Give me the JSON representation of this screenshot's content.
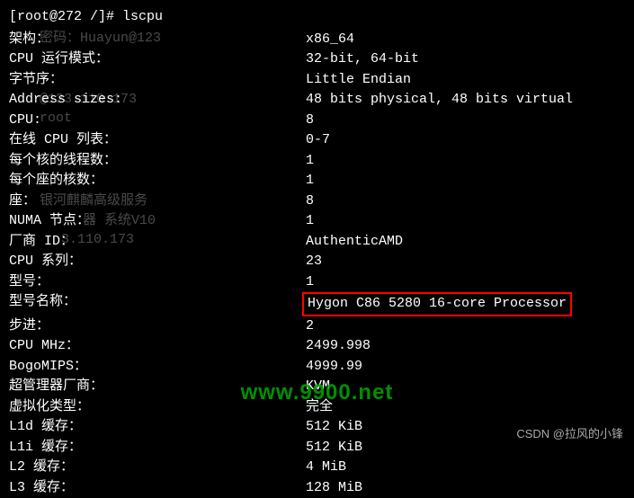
{
  "prompt": "[root@272 /]# lscpu",
  "ghost": {
    "g1": "密码：Huayun@123",
    "g2": "@123.110.173",
    "g3": "root",
    "g4": "银河麒麟高级服务",
    "g5": "器    系统V10",
    "g6": "3.110.173"
  },
  "rows": [
    {
      "label": "架构：",
      "value": "x86_64"
    },
    {
      "label": "CPU 运行模式：",
      "value": "32-bit, 64-bit"
    },
    {
      "label": "字节序：",
      "value": "Little Endian"
    },
    {
      "label": "Address sizes:",
      "value": "48 bits physical, 48 bits virtual"
    },
    {
      "label": "CPU:",
      "value": "8"
    },
    {
      "label": "在线 CPU 列表：",
      "value": "0-7"
    },
    {
      "label": "每个核的线程数：",
      "value": "1"
    },
    {
      "label": "每个座的核数：",
      "value": "1"
    },
    {
      "label": "座：",
      "value": "8"
    },
    {
      "label": "NUMA 节点：",
      "value": "1"
    },
    {
      "label": "厂商 ID：",
      "value": "AuthenticAMD"
    },
    {
      "label": "CPU 系列：",
      "value": "23"
    },
    {
      "label": "型号：",
      "value": "1"
    },
    {
      "label": "型号名称：",
      "value": "Hygon C86 5280 16-core Processor"
    },
    {
      "label": "步进：",
      "value": "2"
    },
    {
      "label": "CPU MHz：",
      "value": "2499.998"
    },
    {
      "label": "BogoMIPS：",
      "value": "4999.99"
    },
    {
      "label": "超管理器厂商：",
      "value": "KVM"
    },
    {
      "label": "虚拟化类型：",
      "value": "完全"
    },
    {
      "label": "L1d 缓存：",
      "value": "512 KiB"
    },
    {
      "label": "L1i 缓存：",
      "value": "512 KiB"
    },
    {
      "label": "L2 缓存：",
      "value": "4 MiB"
    },
    {
      "label": "L3 缓存：",
      "value": "128 MiB"
    }
  ],
  "highlighted_row_index": 13,
  "watermark_green": "www.9900.net",
  "watermark_csdn": "CSDN @拉风的小锋"
}
